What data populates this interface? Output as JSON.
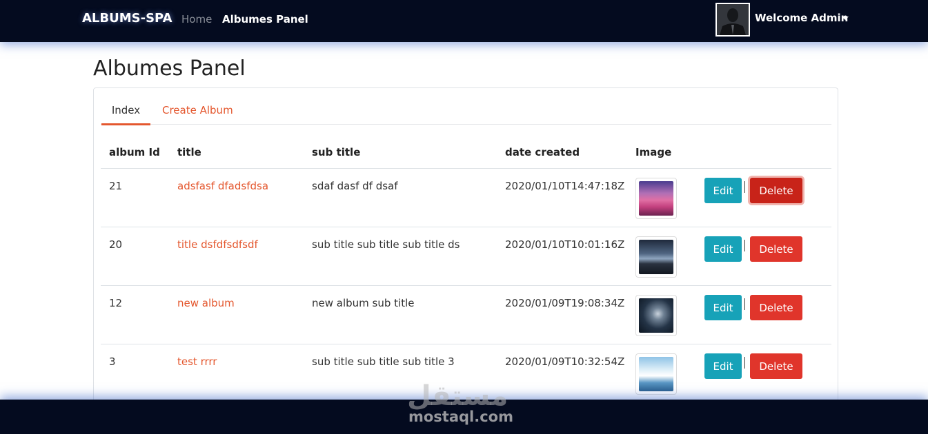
{
  "navbar": {
    "brand": "ALBUMS-SPA",
    "links": [
      {
        "label": "Home"
      },
      {
        "label": "Albumes Panel"
      }
    ],
    "user_label": "Welcome Admin"
  },
  "page": {
    "title": "Albumes Panel"
  },
  "tabs": [
    {
      "label": "Index",
      "active": true
    },
    {
      "label": "Create Album",
      "active": false
    }
  ],
  "table": {
    "headers": [
      "album Id",
      "title",
      "sub title",
      "date created",
      "Image"
    ],
    "rows": [
      {
        "id": "21",
        "title": "adsfasf dfadsfdsa",
        "sub_title": "sdaf dasf df dsaf",
        "date": "2020/01/10T14:47:18Z",
        "image": "flower-field-image",
        "edit": "Edit",
        "delete": "Delete"
      },
      {
        "id": "20",
        "title": "title dsfdfsdfsdf",
        "sub_title": "sub title sub title sub title ds",
        "date": "2020/01/10T10:01:16Z",
        "image": "night-sky-image",
        "edit": "Edit",
        "delete": "Delete"
      },
      {
        "id": "12",
        "title": "new album",
        "sub_title": "new album sub title",
        "date": "2020/01/09T19:08:34Z",
        "image": "shark-image",
        "edit": "Edit",
        "delete": "Delete"
      },
      {
        "id": "3",
        "title": "test rrrr",
        "sub_title": "sub title sub title sub title 3",
        "date": "2020/01/09T10:32:54Z",
        "image": "waterfall-image",
        "edit": "Edit",
        "delete": "Delete"
      }
    ]
  },
  "colors": {
    "navbar_bg": "#040b1f",
    "accent": "#e4572e",
    "edit_button": "#17a2b8",
    "delete_button": "#e0352b"
  },
  "watermark": {
    "arabic": "مستقل",
    "latin": "mostaql.com"
  }
}
